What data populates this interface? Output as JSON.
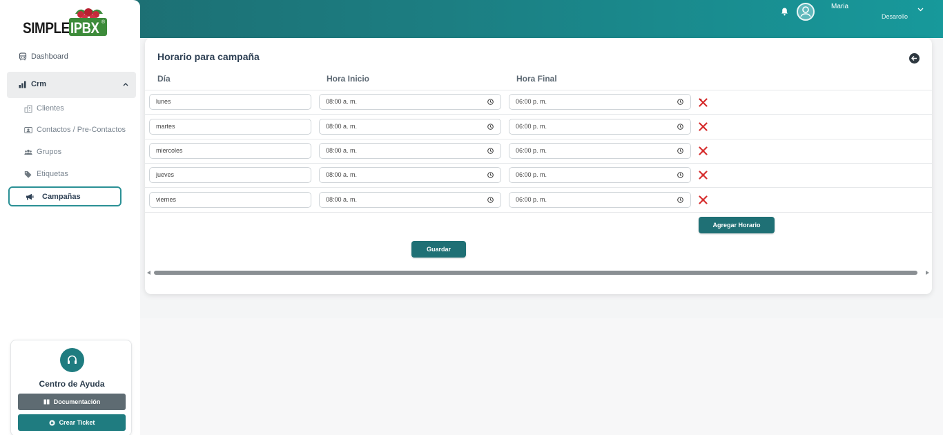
{
  "header": {
    "user_name": "Maria",
    "user_role": "Desarollo",
    "icons": [
      "bell-icon",
      "user-avatar-icon",
      "chevron-down-icon"
    ]
  },
  "sidebar": {
    "logo": {
      "simple": "SIMPLE",
      "ipbx": "IPBX",
      "reg": "®"
    },
    "dashboard": "Dashboard",
    "crm": "Crm",
    "crm_items": [
      {
        "label": "Clientes",
        "icon": "building-icon"
      },
      {
        "label": "Contactos / Pre-Contactos",
        "icon": "contact-card-icon"
      },
      {
        "label": "Grupos",
        "icon": "users-icon"
      },
      {
        "label": "Etiquetas",
        "icon": "tags-icon"
      }
    ],
    "active": {
      "label": "Campañas",
      "icon": "megaphone-icon"
    }
  },
  "help": {
    "title": "Centro de Ayuda",
    "documentacion": "Documentación",
    "crear_ticket": "Crear Ticket"
  },
  "main": {
    "title": "Horario para campaña",
    "columns": {
      "dia": "Día",
      "hora_inicio": "Hora Inicio",
      "hora_final": "Hora Final"
    },
    "rows": [
      {
        "dia": "lunes",
        "inicio": "08:00 a. m.",
        "final": "06:00 p. m."
      },
      {
        "dia": "martes",
        "inicio": "08:00 a. m.",
        "final": "06:00 p. m."
      },
      {
        "dia": "miercoles",
        "inicio": "08:00 a. m.",
        "final": "06:00 p. m."
      },
      {
        "dia": "jueves",
        "inicio": "08:00 a. m.",
        "final": "06:00 p. m."
      },
      {
        "dia": "viernes",
        "inicio": "08:00 a. m.",
        "final": "06:00 p. m."
      }
    ],
    "agregar_label": "Agregar Horario",
    "guardar_label": "Guardar"
  },
  "colors": {
    "accent": "#1f7c80",
    "delete": "#d62d2d",
    "header_start": "#1d6a6e",
    "header_end": "#17999b"
  }
}
